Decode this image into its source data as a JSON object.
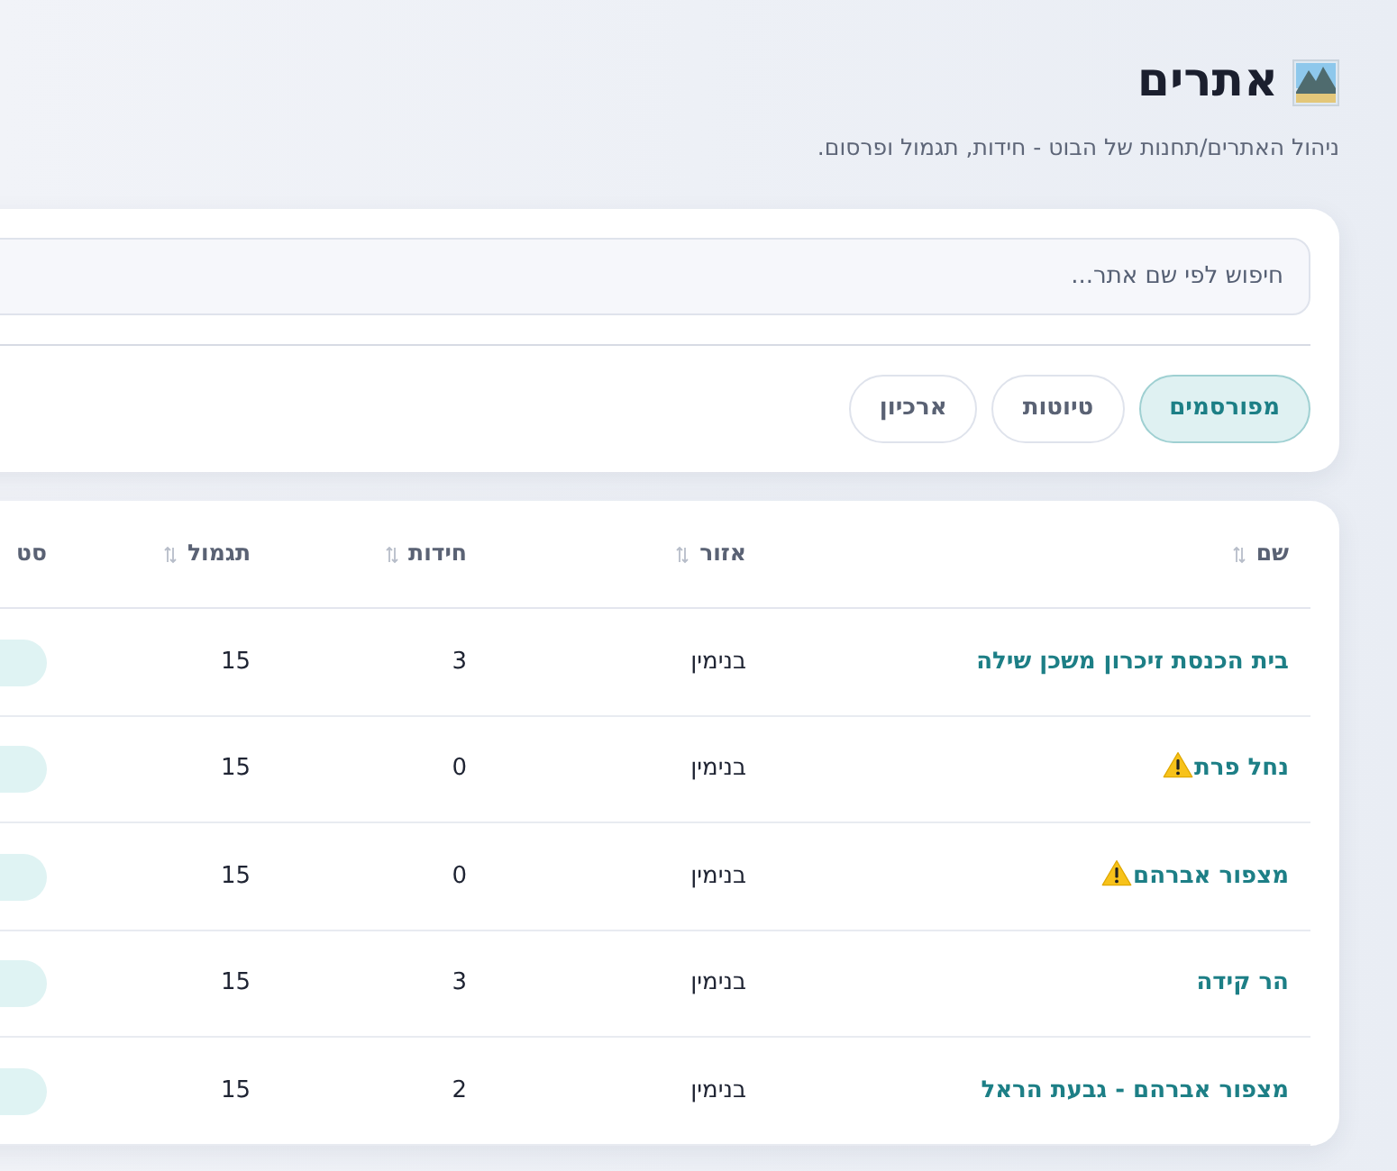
{
  "header": {
    "title": "אתרים",
    "subtitle": "ניהול האתרים/תחנות של הבוט - חידות, תגמול ופרסום."
  },
  "search": {
    "placeholder": "חיפוש לפי שם אתר..."
  },
  "tabs": [
    {
      "label": "מפורסמים",
      "selected": true
    },
    {
      "label": "טיוטות",
      "selected": false
    },
    {
      "label": "ארכיון",
      "selected": false
    }
  ],
  "table": {
    "columns": [
      {
        "label": "שם",
        "sortable": true
      },
      {
        "label": "אזור",
        "sortable": true
      },
      {
        "label": "חידות",
        "sortable": true
      },
      {
        "label": "תגמול",
        "sortable": true
      },
      {
        "label": "סט",
        "sortable": false
      }
    ],
    "rows": [
      {
        "name": "בית הכנסת זיכרון משכן שילה",
        "warning": false,
        "region": "בנימין",
        "riddles": "3",
        "reward": "15"
      },
      {
        "name": "נחל פרת",
        "warning": true,
        "region": "בנימין",
        "riddles": "0",
        "reward": "15"
      },
      {
        "name": "מצפור אברהם",
        "warning": true,
        "region": "בנימין",
        "riddles": "0",
        "reward": "15"
      },
      {
        "name": "הר קידה",
        "warning": false,
        "region": "בנימין",
        "riddles": "3",
        "reward": "15"
      },
      {
        "name": "מצפור אברהם - גבעת הראל",
        "warning": false,
        "region": "בנימין",
        "riddles": "2",
        "reward": "15"
      }
    ]
  }
}
